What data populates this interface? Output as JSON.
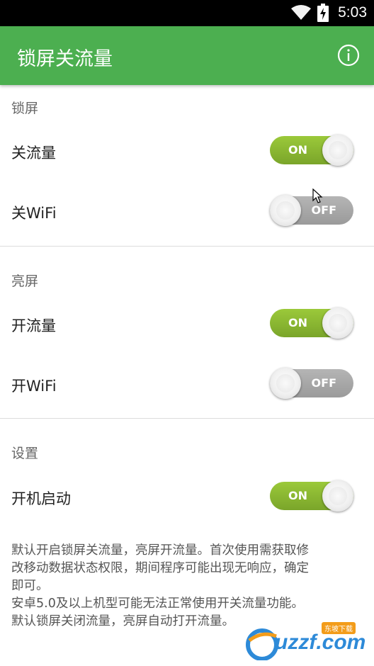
{
  "status_bar": {
    "time": "5:03"
  },
  "app_bar": {
    "title": "锁屏关流量"
  },
  "sections": [
    {
      "header": "锁屏",
      "rows": [
        {
          "label": "关流量",
          "state": "on",
          "toggle_text": "ON"
        },
        {
          "label": "关WiFi",
          "state": "off",
          "toggle_text": "OFF"
        }
      ]
    },
    {
      "header": "亮屏",
      "rows": [
        {
          "label": "开流量",
          "state": "on",
          "toggle_text": "ON"
        },
        {
          "label": "开WiFi",
          "state": "off",
          "toggle_text": "OFF"
        }
      ]
    },
    {
      "header": "设置",
      "rows": [
        {
          "label": "开机启动",
          "state": "on",
          "toggle_text": "ON"
        }
      ]
    }
  ],
  "description": [
    "默认开启锁屏关流量，亮屏开流量。首次使用需获取修",
    "改移动数据状态权限，期间程序可能出现无响应，确定",
    "即可。",
    "安卓5.0及以上机型可能无法正常使用开关流量功能。",
    "默认锁屏关闭流量，亮屏自动打开流量。"
  ],
  "watermark": {
    "text": "uzzf.com",
    "tag": "东坡下载"
  },
  "colors": {
    "accent": "#4caf50",
    "toggle_on": "#8cba34",
    "toggle_off": "#a8a8a8"
  }
}
